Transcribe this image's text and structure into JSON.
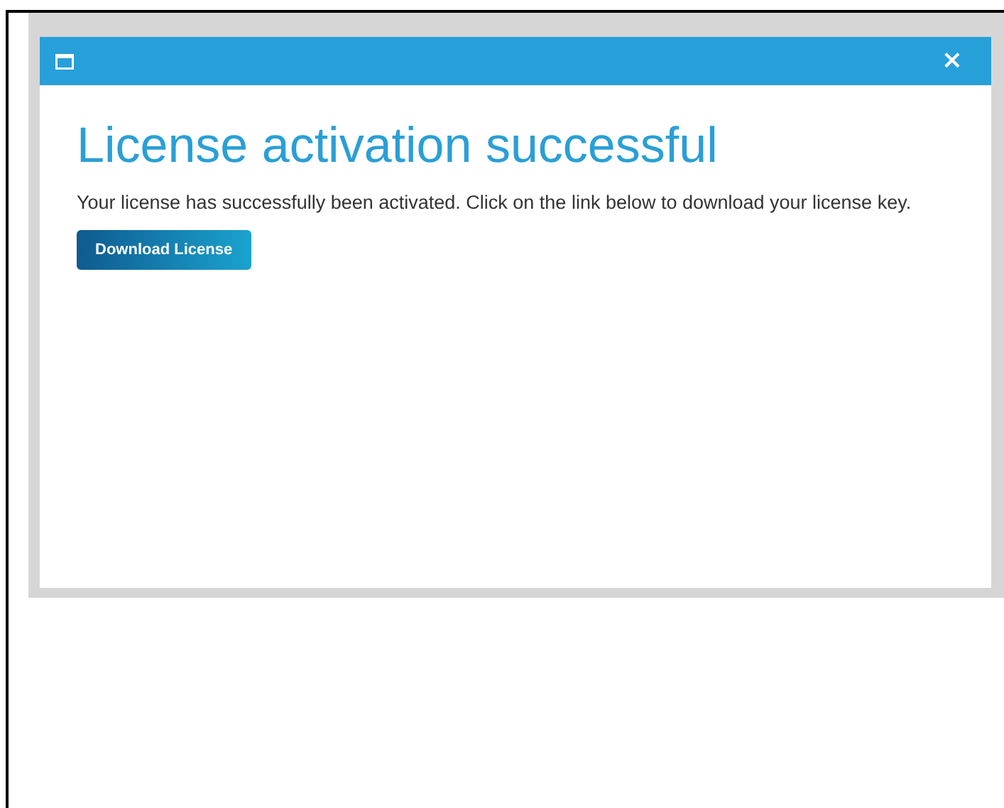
{
  "dialog": {
    "title": "License activation successful",
    "message": "Your license has successfully been activated. Click on the link below to download your license key.",
    "buttons": [
      {
        "label": "Download License",
        "kind": "primary"
      }
    ],
    "close_label": "×"
  }
}
